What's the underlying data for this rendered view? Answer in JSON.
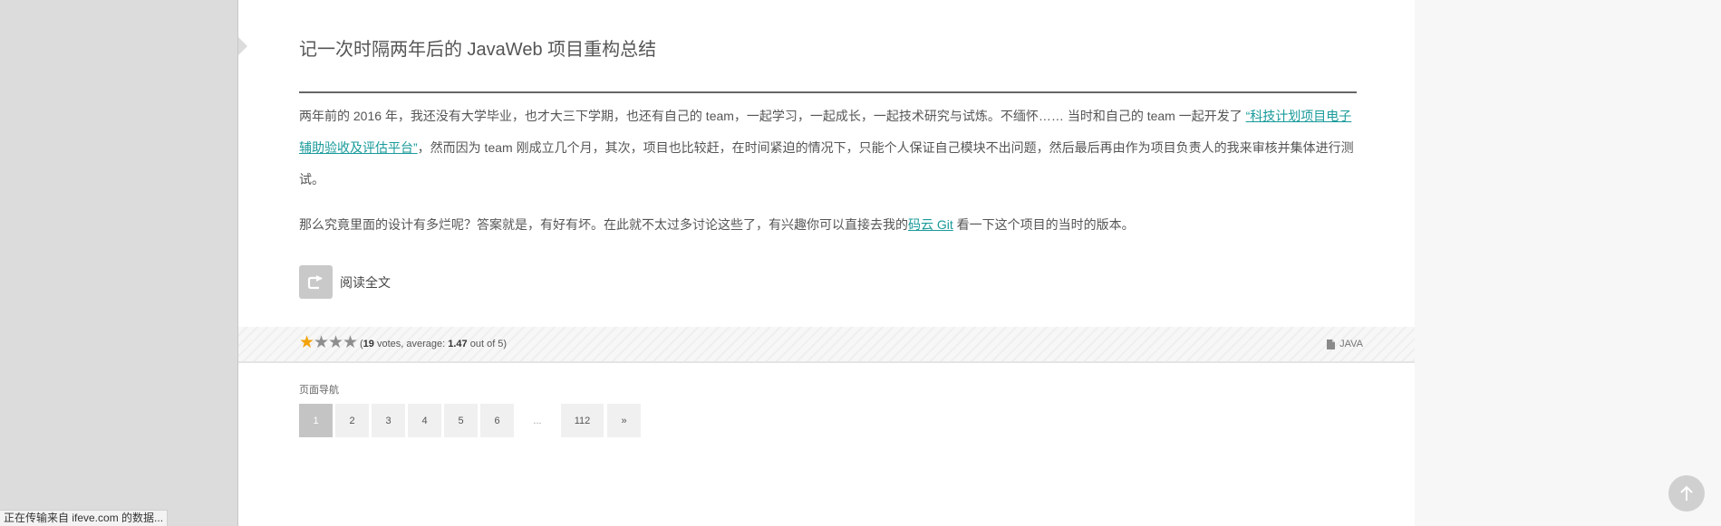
{
  "browser": {
    "status_text": "正在传输来自 ifeve.com 的数据..."
  },
  "post": {
    "title": "记一次时隔两年后的 JavaWeb 项目重构总结",
    "paragraph1": {
      "before_link": "两年前的 2016 年，我还没有大学毕业，也才大三下学期，也还有自己的 team，一起学习，一起成长，一起技术研究与试炼。不缅怀…… 当时和自己的 team 一起开发了 ",
      "link_text": "“科技计划项目电子辅助验收及评估平台”",
      "after_link": "，然而因为 team 刚成立几个月，其次，项目也比较赶，在时间紧迫的情况下，只能个人保证自己模块不出问题，然后最后再由作为项目负责人的我来审核并集体进行测试。"
    },
    "paragraph2": {
      "before_link": "那么究竟里面的设计有多烂呢？答案就是，有好有坏。在此就不太过多讨论这些了，有兴趣你可以直接去我的",
      "link_text": "码云 Git",
      "after_link": " 看一下这个项目的当时的版本。"
    },
    "read_more_label": "阅读全文",
    "read_more_icon": "share-arrow-icon"
  },
  "rating": {
    "stars_filled": 1,
    "stars_total": 4,
    "open_paren": "(",
    "votes": "19",
    "votes_label": " votes, average: ",
    "average": "1.47",
    "out_of": " out of 5)"
  },
  "category": {
    "icon": "document-icon",
    "label": "JAVA"
  },
  "pagination": {
    "label": "页面导航",
    "pages": [
      "1",
      "2",
      "3",
      "4",
      "5",
      "6",
      "...",
      "112",
      "»"
    ],
    "current": "1"
  },
  "colors": {
    "link": "#1a9a9a",
    "star_filled": "#f2a30c",
    "star_empty": "#8e8e8e",
    "left_panel": "#dcdcdc"
  }
}
